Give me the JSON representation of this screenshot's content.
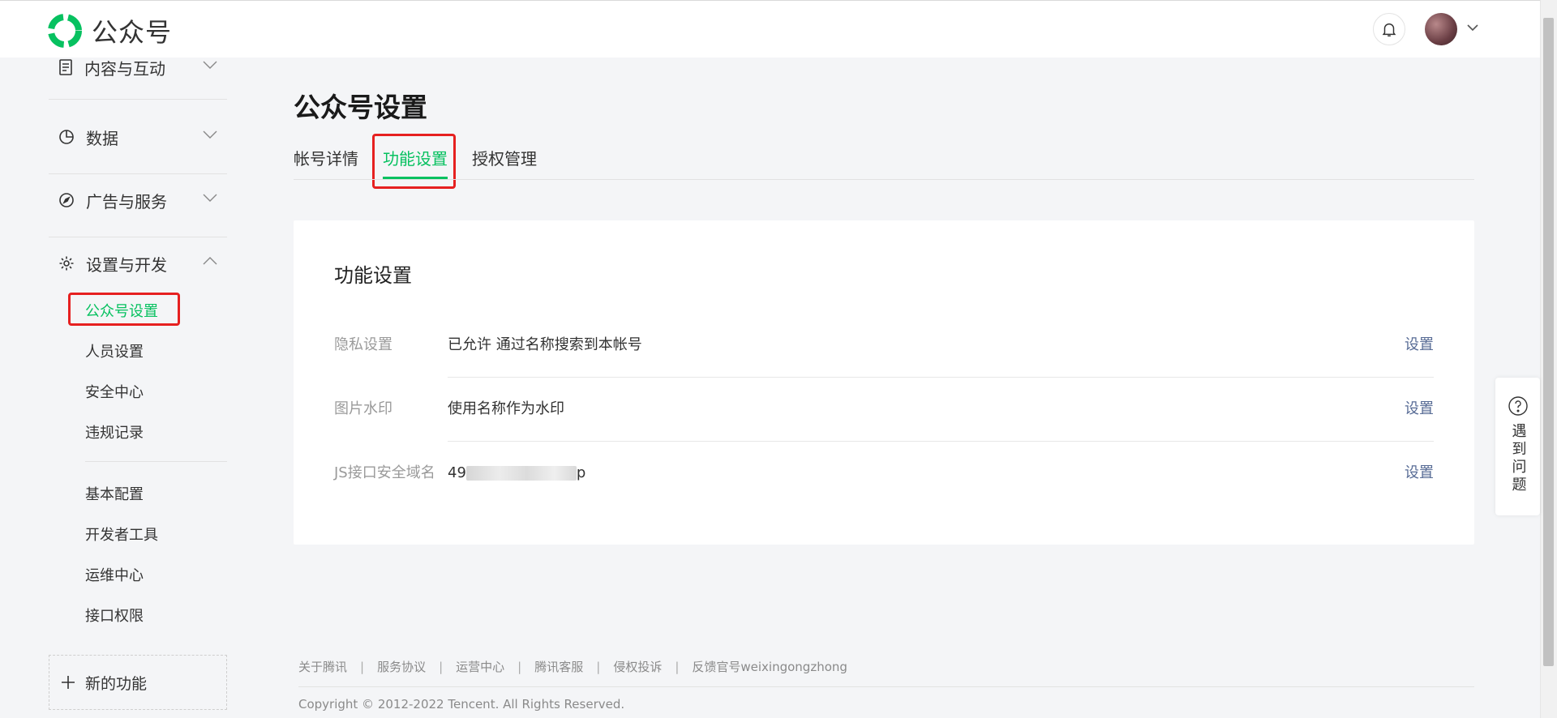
{
  "header": {
    "logo_text": "公众号",
    "brand_color": "#07c160",
    "bell_icon": "bell-icon",
    "avatar_icon": "avatar"
  },
  "sidebar": {
    "groups": [
      {
        "label": "内容与互动",
        "icon": "document-icon",
        "expanded": false
      },
      {
        "label": "数据",
        "icon": "pie-chart-icon",
        "expanded": false
      },
      {
        "label": "广告与服务",
        "icon": "compass-icon",
        "expanded": false
      },
      {
        "label": "设置与开发",
        "icon": "gear-icon",
        "expanded": true
      }
    ],
    "sub_items": [
      "公众号设置",
      "人员设置",
      "安全中心",
      "违规记录"
    ],
    "sub_items2": [
      "基本配置",
      "开发者工具",
      "运维中心",
      "接口权限"
    ],
    "new_feature": "新的功能"
  },
  "main": {
    "title": "公众号设置",
    "tabs": [
      "帐号详情",
      "功能设置",
      "授权管理"
    ],
    "active_tab": "功能设置",
    "card": {
      "title": "功能设置",
      "rows": [
        {
          "key": "隐私设置",
          "value": "已允许 通过名称搜索到本帐号",
          "action": "设置"
        },
        {
          "key": "图片水印",
          "value": "使用名称作为水印",
          "action": "设置"
        },
        {
          "key": "JS接口安全域名",
          "value_prefix": "49",
          "value_suffix": "p",
          "action": "设置"
        }
      ]
    }
  },
  "help": {
    "label": "遇到问题",
    "icon": "question-icon"
  },
  "footer": {
    "links": [
      "关于腾讯",
      "服务协议",
      "运营中心",
      "腾讯客服",
      "侵权投诉",
      "反馈官号weixingongzhong"
    ],
    "copyright": "Copyright © 2012-2022 Tencent. All Rights Reserved."
  }
}
